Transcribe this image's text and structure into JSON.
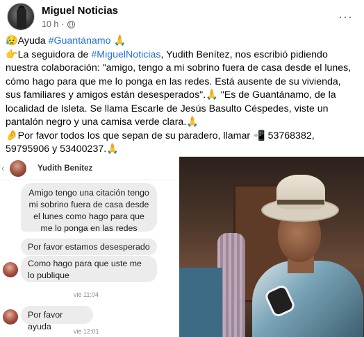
{
  "header": {
    "page_name": "Miguel Noticias",
    "time": "10 h",
    "separator": "·",
    "more": "···"
  },
  "post": {
    "line1_emoji": "😥",
    "line1_text": "Ayuda ",
    "line1_hashtag": "#Guantánamo",
    "line1_end": " 🙏",
    "para_emoji": "👉",
    "para_a": "La seguidora de ",
    "para_hashtag": "#MiguelNoticias",
    "para_b": ", Yudith Benítez, nos escribió pidiendo nuestra colaboración: \"amigo, tengo a mi sobrino fuera de casa desde el lunes, cómo hago para que me lo ponga en las redes. Está ausente de su vivienda, sus familiares y amigos están desesperados\".🙏 \"Es de Guantánamo, de la localidad de Isleta. Se llama Escarle de Jesús Basulto Céspedes, viste un pantalón negro y una camisa verde clara.🙏",
    "call_emoji": "🤌",
    "call_text": "Por favor todos los que sepan de su paradero, llamar 📲 53768382, 59795906 y 53400237.🙏"
  },
  "chat": {
    "back": "‹",
    "contact_name": "Yudith Benitez",
    "message1_lines": [
      "Amigo tengo una citación tengo",
      "mi sobrino fuera de casa desde",
      "el lunes como hago para que",
      "me lo ponga en las redes"
    ],
    "message2": "Por favor estamos desesperado",
    "message3": "Como hago para que uste me lo publique",
    "timestamp1": "vie 11:04",
    "message4": "Por favor ayuda",
    "timestamp2": "vie 12:01"
  },
  "colors": {
    "hashtag": "#216fdb",
    "meta": "#65676b",
    "bubble": "#ececec"
  }
}
